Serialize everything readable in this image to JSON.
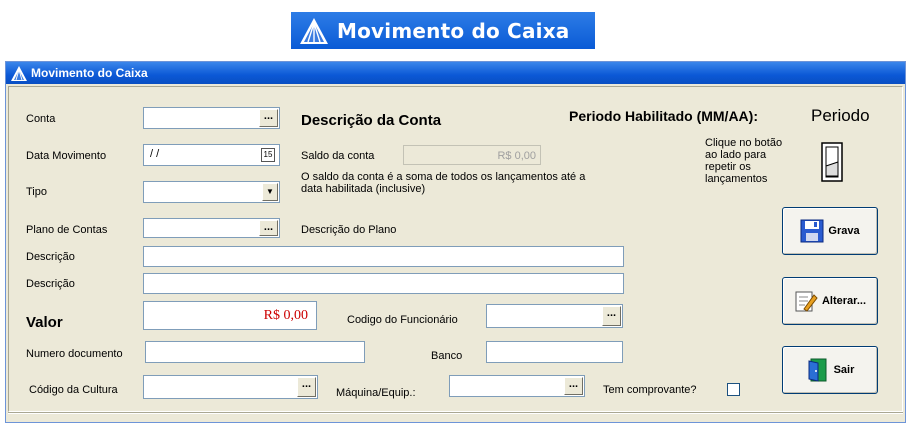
{
  "banner": {
    "title": "Movimento do Caixa"
  },
  "window": {
    "title": "Movimento do Caixa"
  },
  "form": {
    "conta_label": "Conta",
    "conta_value": "",
    "descricao_conta_heading": "Descrição da Conta",
    "periodo_label": "Periodo Habilitado (MM/AA):",
    "periodo_value": "Periodo",
    "data_movimento_label": "Data Movimento",
    "data_movimento_value": "/ /",
    "calendar_icon_text": "15",
    "saldo_label": "Saldo da conta",
    "saldo_value": "R$ 0,00",
    "saldo_note": "O saldo da conta é a soma de todos os lançamentos até a data habilitada (inclusive)",
    "tipo_label": "Tipo",
    "tipo_value": "",
    "repeat_hint": "Clique no botão ao lado para repetir os lançamentos",
    "plano_label": "Plano de Contas",
    "plano_value": "",
    "descricao_plano_label": "Descrição do Plano",
    "descricao1_label": "Descrição",
    "descricao1_value": "",
    "descricao2_label": "Descrição",
    "descricao2_value": "",
    "valor_label": "Valor",
    "valor_value": "R$ 0,00",
    "codigo_funcionario_label": "Codigo do Funcionário",
    "codigo_funcionario_value": "",
    "numero_documento_label": "Numero documento",
    "numero_documento_value": "",
    "banco_label": "Banco",
    "banco_value": "",
    "codigo_cultura_label": "Código da Cultura",
    "codigo_cultura_value": "",
    "maquina_label": "Máquina/Equip.:",
    "maquina_value": "",
    "comprovante_label": "Tem comprovante?",
    "comprovante_checked": false,
    "dots": "..."
  },
  "buttons": {
    "grava": "Grava",
    "alterar": "Alterar...",
    "sair": "Sair"
  },
  "colors": {
    "valor_text": "#cc0000",
    "titlebar": "#0b58d6",
    "banner": "#1e6ee2"
  }
}
